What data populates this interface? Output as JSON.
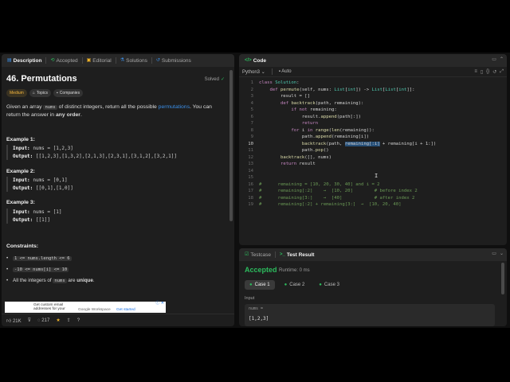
{
  "left": {
    "tabs": [
      {
        "icon": "description-icon",
        "label": "Description"
      },
      {
        "icon": "accepted-icon",
        "label": "Accepted"
      },
      {
        "icon": "editorial-icon",
        "label": "Editorial"
      },
      {
        "icon": "solutions-icon",
        "label": "Solutions"
      },
      {
        "icon": "submissions-icon",
        "label": "Submissions"
      }
    ],
    "title": "46. Permutations",
    "solved": "Solved",
    "badges": {
      "difficulty": "Medium",
      "topics": "Topics",
      "companies": "Companies"
    },
    "desc": {
      "p1": "Given an array ",
      "code": "nums",
      "p2": " of distinct integers, return all the possible ",
      "link": "permutations",
      "p3": ". You can return the answer in ",
      "bold": "any order",
      "p4": "."
    },
    "examples": [
      {
        "title": "Example 1:",
        "input_label": "Input:",
        "input": "nums = [1,2,3]",
        "output_label": "Output:",
        "output": "[[1,2,3],[1,3,2],[2,1,3],[2,3,1],[3,1,2],[3,2,1]]"
      },
      {
        "title": "Example 2:",
        "input_label": "Input:",
        "input": "nums = [0,1]",
        "output_label": "Output:",
        "output": "[[0,1],[1,0]]"
      },
      {
        "title": "Example 3:",
        "input_label": "Input:",
        "input": "nums = [1]",
        "output_label": "Output:",
        "output": "[[1]]"
      }
    ],
    "constraints_title": "Constraints:",
    "constraints": [
      {
        "code": "1 <= nums.length <= 6",
        "text": ""
      },
      {
        "code": "-10 <= nums[i] <= 10",
        "text": ""
      },
      {
        "pre": "All the integers of ",
        "code": "nums",
        "text": " are ",
        "bold": "unique",
        "post": "."
      }
    ],
    "ad": {
      "line1": "Get custom email",
      "line2": "addresses for your",
      "brand": "Google Workspace",
      "cta": "Get started",
      "close": "ⓘ ✕"
    },
    "footer": {
      "likes": "21K",
      "comments": "217"
    }
  },
  "code": {
    "tab": "Code",
    "language": "Python3",
    "mode": "Auto",
    "lines": [
      "class Solution:",
      "    def permute(self, nums: List[int]) -> List[List[int]]:",
      "        result = []",
      "        def backtrack(path, remaining):",
      "            if not remaining:",
      "                result.append(path[:])",
      "                return",
      "            for i in range(len(remaining)):",
      "                path.append(remaining[i])",
      "                backtrack(path, remaining[:i] + remaining[i + 1:])",
      "                path.pop()",
      "        backtrack([], nums)",
      "        return result",
      "",
      "",
      "#      remaining = [10, 20, 30, 40] and i = 2",
      "#      remaining[:2]    →  [10, 20]        # before index 2",
      "#      remaining[3:]    →  [40]            # after index 2",
      "#      remaining[:2] + remaining[3:]  →  [10, 20, 40]"
    ],
    "current_line": 10
  },
  "test": {
    "tabs": [
      {
        "icon": "testcase-icon",
        "label": "Testcase"
      },
      {
        "icon": "terminal-icon",
        "label": "Test Result"
      }
    ],
    "status": "Accepted",
    "runtime": "Runtime: 0 ms",
    "cases": [
      "Case 1",
      "Case 2",
      "Case 3"
    ],
    "input_label": "Input",
    "var": "nums =",
    "value": "[1,2,3]"
  },
  "colors": {
    "accent": "#3b8fe8",
    "success": "#2cbb5d",
    "medium": "#f6b73c",
    "panel": "#1e1e1e"
  }
}
